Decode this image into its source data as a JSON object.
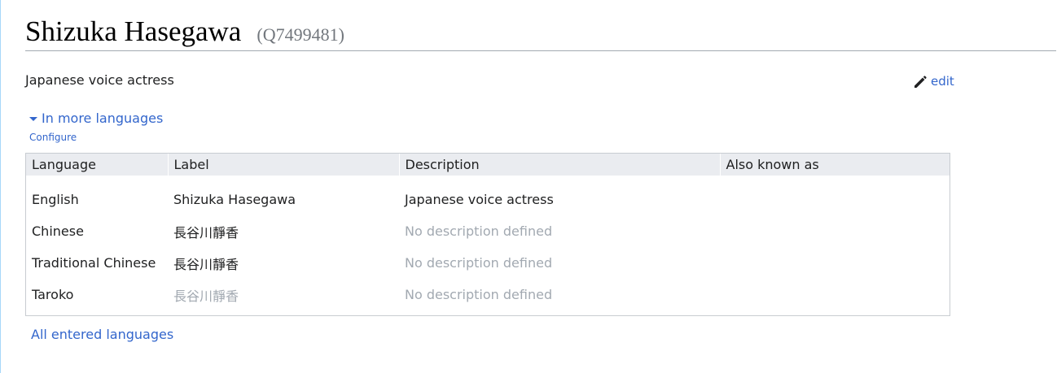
{
  "entity": {
    "label": "Shizuka Hasegawa",
    "qid": "(Q7499481)",
    "description": "Japanese voice actress"
  },
  "actions": {
    "edit_label": "edit",
    "toggle_label": "In more languages",
    "configure_label": "Configure",
    "all_languages_label": "All entered languages"
  },
  "table": {
    "headers": {
      "language": "Language",
      "label": "Label",
      "description": "Description",
      "aliases": "Also known as"
    },
    "rows": [
      {
        "language": "English",
        "label": "Shizuka Hasegawa",
        "description": "Japanese voice actress",
        "aliases": ""
      },
      {
        "language": "Chinese",
        "label": "長谷川靜香",
        "description": "No description defined",
        "aliases": ""
      },
      {
        "language": "Traditional Chinese",
        "label": "長谷川靜香",
        "description": "No description defined",
        "aliases": ""
      },
      {
        "language": "Taroko",
        "label": "長谷川靜香",
        "description": "No description defined",
        "aliases": ""
      }
    ]
  },
  "colors": {
    "link": "#3366cc",
    "muted": "#a2a9b1",
    "header_bg": "#eaecf0"
  },
  "icons": {
    "edit": "pencil-icon",
    "toggle": "caret-down-icon"
  }
}
